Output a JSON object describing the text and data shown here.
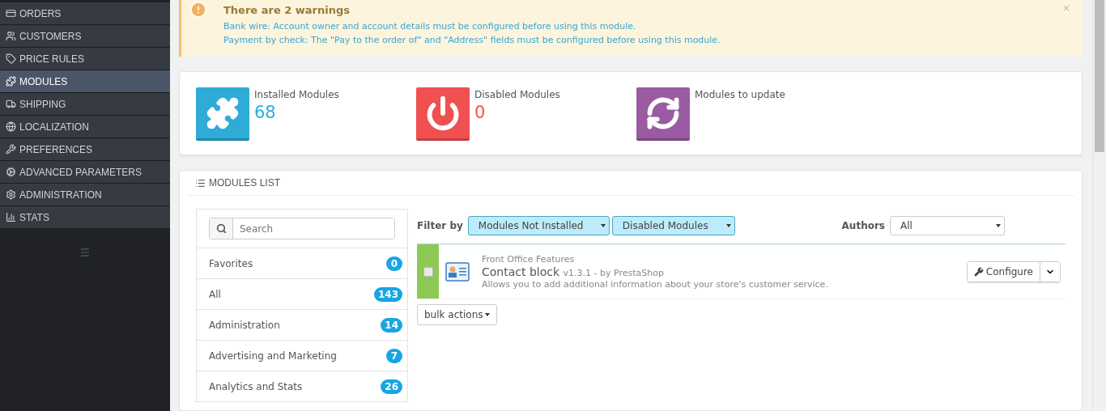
{
  "sidebar": {
    "items": [
      {
        "label": "ORDERS",
        "selected": false
      },
      {
        "label": "CUSTOMERS",
        "selected": false
      },
      {
        "label": "PRICE RULES",
        "selected": false
      },
      {
        "label": "MODULES",
        "selected": true
      },
      {
        "label": "SHIPPING",
        "selected": false
      },
      {
        "label": "LOCALIZATION",
        "selected": false
      },
      {
        "label": "PREFERENCES",
        "selected": false
      },
      {
        "label": "ADVANCED PARAMETERS",
        "selected": false
      },
      {
        "label": "ADMINISTRATION",
        "selected": false
      },
      {
        "label": "STATS",
        "selected": false
      }
    ]
  },
  "warning": {
    "title": "There are 2 warnings",
    "messages": [
      "Bank wire: Account owner and account details must be configured before using this module.",
      "Payment by check: The \"Pay to the order of\" and \"Address\" fields must be configured before using this module."
    ]
  },
  "stats": [
    {
      "kind": "installed",
      "label": "Installed Modules",
      "value": "68",
      "color": "#2eacd7"
    },
    {
      "kind": "disabled",
      "label": "Disabled Modules",
      "value": "0",
      "color": "#f05050"
    },
    {
      "kind": "update",
      "label": "Modules to update",
      "color": "#9a5ba3"
    }
  ],
  "modules_list": {
    "title": "MODULES LIST",
    "search": {
      "placeholder": "Search"
    },
    "categories": [
      {
        "label": "Favorites",
        "count": "0"
      },
      {
        "label": "All",
        "count": "143"
      },
      {
        "label": "Administration",
        "count": "14"
      },
      {
        "label": "Advertising and Marketing",
        "count": "7"
      },
      {
        "label": "Analytics and Stats",
        "count": "26"
      }
    ],
    "filter": {
      "label": "Filter by",
      "selects": [
        "Modules Not Installed",
        "Disabled Modules"
      ],
      "authors_label": "Authors",
      "authors_value": "All"
    },
    "modules": [
      {
        "category": "Front Office Features",
        "name": "Contact block",
        "version": "v1.3.1 - by PrestaShop",
        "description": "Allows you to add additional information about your store's customer service.",
        "checked": false,
        "color": "#8bc954",
        "action": "Configure"
      }
    ],
    "bulk_actions": "bulk actions"
  }
}
